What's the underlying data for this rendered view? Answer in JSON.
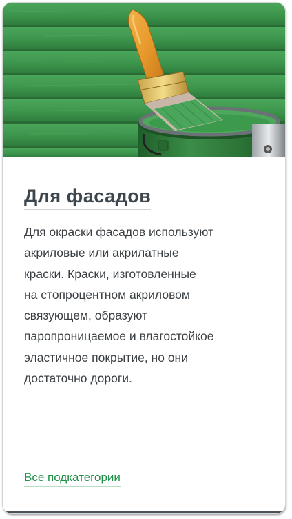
{
  "card": {
    "title": "Для фасадов",
    "description_lines": [
      "Для окраски фасадов используют",
      "акриловые или акрилатные",
      "краски. Краски, изготовленные",
      "на стопроцентном акриловом",
      "связующем, образуют",
      "паропроницаемое и влагостойкое",
      "эластичное покрытие, но они",
      "достаточно дороги."
    ],
    "link_label": "Все подкатегории"
  },
  "colors": {
    "title": "#3d464c",
    "body_text": "#3a3f43",
    "link": "#1f9146",
    "siding_green": "#3f9a4f",
    "paint_can": "#2f7a3c"
  },
  "image": {
    "semantic": "paintbrush-in-green-paint-can-on-green-siding"
  }
}
